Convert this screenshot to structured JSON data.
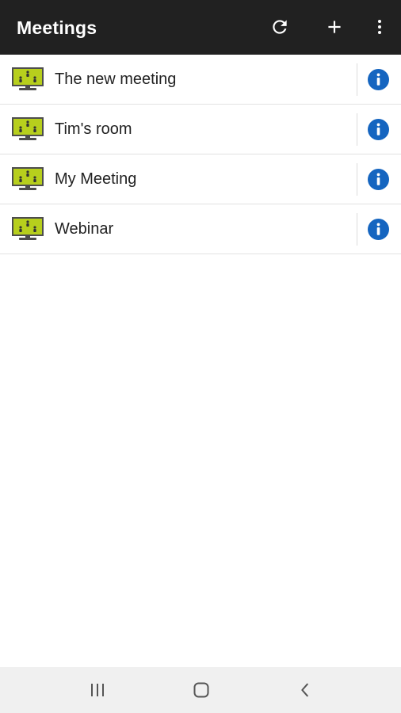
{
  "app_bar": {
    "title": "Meetings",
    "actions": [
      {
        "icon": "refresh-icon"
      },
      {
        "icon": "plus-icon"
      },
      {
        "icon": "more-vert-icon"
      }
    ]
  },
  "meetings": [
    {
      "name": "The new meeting",
      "icon": "meeting-room-icon",
      "action_icon": "info-icon"
    },
    {
      "name": "Tim's room",
      "icon": "meeting-room-icon",
      "action_icon": "info-icon"
    },
    {
      "name": "My Meeting",
      "icon": "meeting-room-icon",
      "action_icon": "info-icon"
    },
    {
      "name": "Webinar",
      "icon": "meeting-room-icon",
      "action_icon": "info-icon"
    }
  ],
  "nav_bar": {
    "buttons": [
      {
        "icon": "recent-apps-icon"
      },
      {
        "icon": "home-icon"
      },
      {
        "icon": "back-icon"
      }
    ]
  },
  "colors": {
    "app_bar": "#212121",
    "info_blue": "#1565c0",
    "screen_green": "#b7cf1d",
    "nav_bar": "#f0f0f0"
  }
}
